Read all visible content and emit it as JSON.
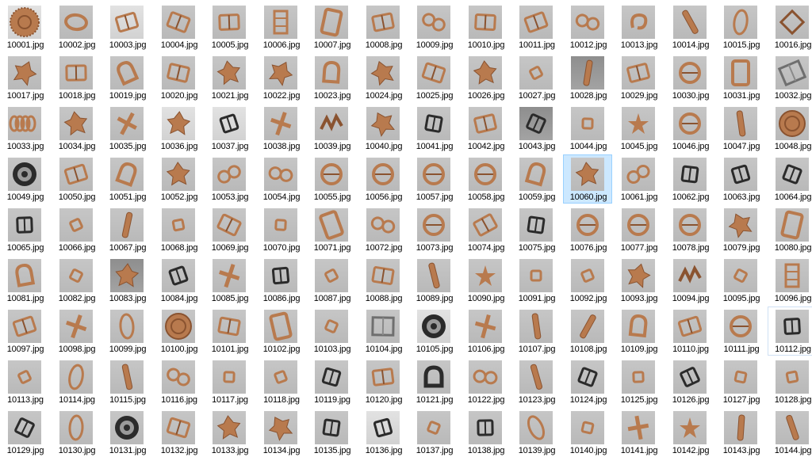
{
  "explorer": {
    "view_mode": "large-icons",
    "selected_item": "10060.jpg",
    "focused_item": "10112.jpg",
    "items": [
      {
        "name": "10001.jpg",
        "thumbnail": "woven-disc"
      },
      {
        "name": "10002.jpg",
        "thumbnail": "slanted-ring"
      },
      {
        "name": "10003.jpg",
        "thumbnail": "rect-buckle"
      },
      {
        "name": "10004.jpg",
        "thumbnail": "rect-buckle"
      },
      {
        "name": "10005.jpg",
        "thumbnail": "rect-buckle"
      },
      {
        "name": "10006.jpg",
        "thumbnail": "ladder-buckle"
      },
      {
        "name": "10007.jpg",
        "thumbnail": "tall-frame"
      },
      {
        "name": "10008.jpg",
        "thumbnail": "rect-buckle"
      },
      {
        "name": "10009.jpg",
        "thumbnail": "figure-eight"
      },
      {
        "name": "10010.jpg",
        "thumbnail": "rect-buckle"
      },
      {
        "name": "10011.jpg",
        "thumbnail": "rect-buckle"
      },
      {
        "name": "10012.jpg",
        "thumbnail": "figure-eight"
      },
      {
        "name": "10013.jpg",
        "thumbnail": "hook"
      },
      {
        "name": "10014.jpg",
        "thumbnail": "bar"
      },
      {
        "name": "10015.jpg",
        "thumbnail": "oval-ring"
      },
      {
        "name": "10016.jpg",
        "thumbnail": "diamond-ring"
      },
      {
        "name": "10017.jpg",
        "thumbnail": "ornament"
      },
      {
        "name": "10018.jpg",
        "thumbnail": "rect-buckle"
      },
      {
        "name": "10019.jpg",
        "thumbnail": "d-ring"
      },
      {
        "name": "10020.jpg",
        "thumbnail": "rect-buckle"
      },
      {
        "name": "10021.jpg",
        "thumbnail": "ornament"
      },
      {
        "name": "10022.jpg",
        "thumbnail": "ornament"
      },
      {
        "name": "10023.jpg",
        "thumbnail": "d-ring"
      },
      {
        "name": "10024.jpg",
        "thumbnail": "ornament"
      },
      {
        "name": "10025.jpg",
        "thumbnail": "rect-buckle"
      },
      {
        "name": "10026.jpg",
        "thumbnail": "ornament"
      },
      {
        "name": "10027.jpg",
        "thumbnail": "small-ring"
      },
      {
        "name": "10028.jpg",
        "thumbnail": "bar"
      },
      {
        "name": "10029.jpg",
        "thumbnail": "rect-buckle"
      },
      {
        "name": "10030.jpg",
        "thumbnail": "round-ring"
      },
      {
        "name": "10031.jpg",
        "thumbnail": "tall-frame"
      },
      {
        "name": "10032.jpg",
        "thumbnail": "metal-frame"
      },
      {
        "name": "10033.jpg",
        "thumbnail": "chain"
      },
      {
        "name": "10034.jpg",
        "thumbnail": "ornament"
      },
      {
        "name": "10035.jpg",
        "thumbnail": "cross"
      },
      {
        "name": "10036.jpg",
        "thumbnail": "ornament"
      },
      {
        "name": "10037.jpg",
        "thumbnail": "black-buckle"
      },
      {
        "name": "10038.jpg",
        "thumbnail": "cross"
      },
      {
        "name": "10039.jpg",
        "thumbnail": "zigzag"
      },
      {
        "name": "10040.jpg",
        "thumbnail": "ornament"
      },
      {
        "name": "10041.jpg",
        "thumbnail": "black-buckle"
      },
      {
        "name": "10042.jpg",
        "thumbnail": "rect-buckle"
      },
      {
        "name": "10043.jpg",
        "thumbnail": "black-buckle"
      },
      {
        "name": "10044.jpg",
        "thumbnail": "small-ring"
      },
      {
        "name": "10045.jpg",
        "thumbnail": "star"
      },
      {
        "name": "10046.jpg",
        "thumbnail": "round-ring"
      },
      {
        "name": "10047.jpg",
        "thumbnail": "bar"
      },
      {
        "name": "10048.jpg",
        "thumbnail": "round-plate"
      },
      {
        "name": "10049.jpg",
        "thumbnail": "black-disc"
      },
      {
        "name": "10050.jpg",
        "thumbnail": "rect-buckle"
      },
      {
        "name": "10051.jpg",
        "thumbnail": "d-ring"
      },
      {
        "name": "10052.jpg",
        "thumbnail": "ornament"
      },
      {
        "name": "10053.jpg",
        "thumbnail": "figure-eight"
      },
      {
        "name": "10054.jpg",
        "thumbnail": "figure-eight"
      },
      {
        "name": "10055.jpg",
        "thumbnail": "round-ring"
      },
      {
        "name": "10056.jpg",
        "thumbnail": "round-ring"
      },
      {
        "name": "10057.jpg",
        "thumbnail": "round-ring"
      },
      {
        "name": "10058.jpg",
        "thumbnail": "round-ring"
      },
      {
        "name": "10059.jpg",
        "thumbnail": "d-ring"
      },
      {
        "name": "10060.jpg",
        "thumbnail": "ornament"
      },
      {
        "name": "10061.jpg",
        "thumbnail": "figure-eight"
      },
      {
        "name": "10062.jpg",
        "thumbnail": "black-buckle"
      },
      {
        "name": "10063.jpg",
        "thumbnail": "black-buckle"
      },
      {
        "name": "10064.jpg",
        "thumbnail": "black-buckle"
      },
      {
        "name": "10065.jpg",
        "thumbnail": "black-buckle"
      },
      {
        "name": "10066.jpg",
        "thumbnail": "small-ring"
      },
      {
        "name": "10067.jpg",
        "thumbnail": "bar"
      },
      {
        "name": "10068.jpg",
        "thumbnail": "small-ring"
      },
      {
        "name": "10069.jpg",
        "thumbnail": "rect-buckle"
      },
      {
        "name": "10070.jpg",
        "thumbnail": "small-ring"
      },
      {
        "name": "10071.jpg",
        "thumbnail": "tall-frame"
      },
      {
        "name": "10072.jpg",
        "thumbnail": "figure-eight"
      },
      {
        "name": "10073.jpg",
        "thumbnail": "round-ring"
      },
      {
        "name": "10074.jpg",
        "thumbnail": "rect-buckle"
      },
      {
        "name": "10075.jpg",
        "thumbnail": "black-buckle"
      },
      {
        "name": "10076.jpg",
        "thumbnail": "round-ring"
      },
      {
        "name": "10077.jpg",
        "thumbnail": "round-ring"
      },
      {
        "name": "10078.jpg",
        "thumbnail": "round-ring"
      },
      {
        "name": "10079.jpg",
        "thumbnail": "ornament"
      },
      {
        "name": "10080.jpg",
        "thumbnail": "tall-frame"
      },
      {
        "name": "10081.jpg",
        "thumbnail": "d-ring"
      },
      {
        "name": "10082.jpg",
        "thumbnail": "small-ring"
      },
      {
        "name": "10083.jpg",
        "thumbnail": "ornament"
      },
      {
        "name": "10084.jpg",
        "thumbnail": "black-buckle"
      },
      {
        "name": "10085.jpg",
        "thumbnail": "cross"
      },
      {
        "name": "10086.jpg",
        "thumbnail": "black-buckle"
      },
      {
        "name": "10087.jpg",
        "thumbnail": "small-ring"
      },
      {
        "name": "10088.jpg",
        "thumbnail": "rect-buckle"
      },
      {
        "name": "10089.jpg",
        "thumbnail": "bar"
      },
      {
        "name": "10090.jpg",
        "thumbnail": "star"
      },
      {
        "name": "10091.jpg",
        "thumbnail": "small-ring"
      },
      {
        "name": "10092.jpg",
        "thumbnail": "small-ring"
      },
      {
        "name": "10093.jpg",
        "thumbnail": "ornament"
      },
      {
        "name": "10094.jpg",
        "thumbnail": "zigzag"
      },
      {
        "name": "10095.jpg",
        "thumbnail": "small-ring"
      },
      {
        "name": "10096.jpg",
        "thumbnail": "ladder-buckle"
      },
      {
        "name": "10097.jpg",
        "thumbnail": "rect-buckle"
      },
      {
        "name": "10098.jpg",
        "thumbnail": "cross"
      },
      {
        "name": "10099.jpg",
        "thumbnail": "oval-ring"
      },
      {
        "name": "10100.jpg",
        "thumbnail": "round-plate"
      },
      {
        "name": "10101.jpg",
        "thumbnail": "rect-buckle"
      },
      {
        "name": "10102.jpg",
        "thumbnail": "tall-frame"
      },
      {
        "name": "10103.jpg",
        "thumbnail": "small-ring"
      },
      {
        "name": "10104.jpg",
        "thumbnail": "metal-frame"
      },
      {
        "name": "10105.jpg",
        "thumbnail": "black-disc"
      },
      {
        "name": "10106.jpg",
        "thumbnail": "cross"
      },
      {
        "name": "10107.jpg",
        "thumbnail": "bar"
      },
      {
        "name": "10108.jpg",
        "thumbnail": "bar"
      },
      {
        "name": "10109.jpg",
        "thumbnail": "d-ring"
      },
      {
        "name": "10110.jpg",
        "thumbnail": "rect-buckle"
      },
      {
        "name": "10111.jpg",
        "thumbnail": "round-ring"
      },
      {
        "name": "10112.jpg",
        "thumbnail": "black-buckle"
      },
      {
        "name": "10113.jpg",
        "thumbnail": "small-ring"
      },
      {
        "name": "10114.jpg",
        "thumbnail": "oval-ring"
      },
      {
        "name": "10115.jpg",
        "thumbnail": "bar"
      },
      {
        "name": "10116.jpg",
        "thumbnail": "figure-eight"
      },
      {
        "name": "10117.jpg",
        "thumbnail": "small-ring"
      },
      {
        "name": "10118.jpg",
        "thumbnail": "small-ring"
      },
      {
        "name": "10119.jpg",
        "thumbnail": "black-buckle"
      },
      {
        "name": "10120.jpg",
        "thumbnail": "rect-buckle"
      },
      {
        "name": "10121.jpg",
        "thumbnail": "black-d-ring"
      },
      {
        "name": "10122.jpg",
        "thumbnail": "figure-eight"
      },
      {
        "name": "10123.jpg",
        "thumbnail": "bar"
      },
      {
        "name": "10124.jpg",
        "thumbnail": "black-buckle"
      },
      {
        "name": "10125.jpg",
        "thumbnail": "small-ring"
      },
      {
        "name": "10126.jpg",
        "thumbnail": "black-buckle"
      },
      {
        "name": "10127.jpg",
        "thumbnail": "small-ring"
      },
      {
        "name": "10128.jpg",
        "thumbnail": "small-ring"
      },
      {
        "name": "10129.jpg",
        "thumbnail": "black-buckle"
      },
      {
        "name": "10130.jpg",
        "thumbnail": "oval-ring"
      },
      {
        "name": "10131.jpg",
        "thumbnail": "black-disc"
      },
      {
        "name": "10132.jpg",
        "thumbnail": "rect-buckle"
      },
      {
        "name": "10133.jpg",
        "thumbnail": "ornament"
      },
      {
        "name": "10134.jpg",
        "thumbnail": "ornament"
      },
      {
        "name": "10135.jpg",
        "thumbnail": "black-buckle"
      },
      {
        "name": "10136.jpg",
        "thumbnail": "black-buckle"
      },
      {
        "name": "10137.jpg",
        "thumbnail": "small-ring"
      },
      {
        "name": "10138.jpg",
        "thumbnail": "black-buckle"
      },
      {
        "name": "10139.jpg",
        "thumbnail": "oval-ring"
      },
      {
        "name": "10140.jpg",
        "thumbnail": "small-ring"
      },
      {
        "name": "10141.jpg",
        "thumbnail": "cross"
      },
      {
        "name": "10142.jpg",
        "thumbnail": "star"
      },
      {
        "name": "10143.jpg",
        "thumbnail": "bar"
      },
      {
        "name": "10144.jpg",
        "thumbnail": "bar"
      }
    ]
  },
  "colors": {
    "selection_fill": "#cce8ff",
    "selection_border": "#99d1ff",
    "thumb_background": "#bfbfbf",
    "copper": "#b87a4e",
    "copper_dark": "#8a5330",
    "black_metal": "#2b2b2b"
  }
}
